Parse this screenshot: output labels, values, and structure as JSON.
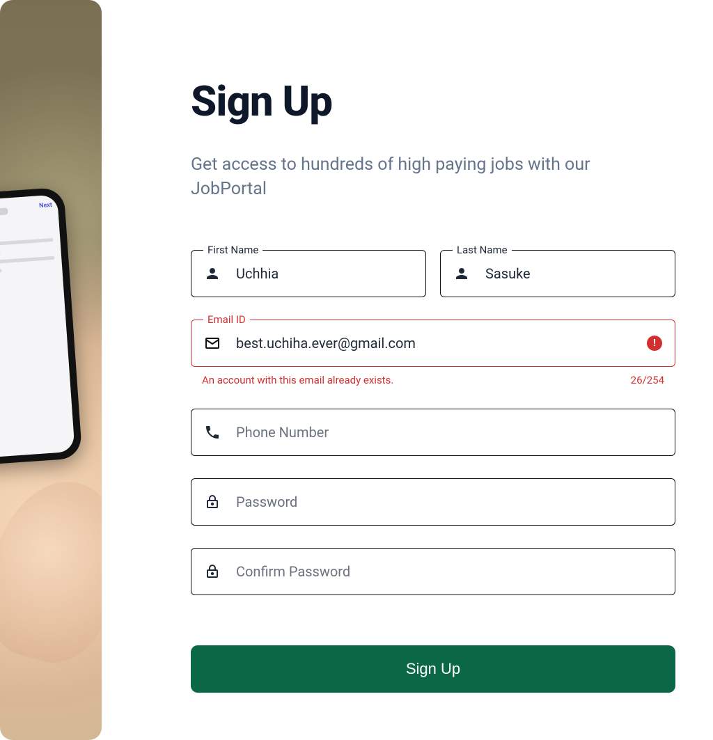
{
  "header": {
    "title": "Sign Up",
    "subtitle": "Get access to hundreds of high paying jobs with our JobPortal"
  },
  "fields": {
    "first_name": {
      "label": "First Name",
      "value": "Uchhia"
    },
    "last_name": {
      "label": "Last Name",
      "value": "Sasuke"
    },
    "email": {
      "label": "Email ID",
      "value": "best.uchiha.ever@gmail.com",
      "error": "An account with this email already exists.",
      "counter": "26/254"
    },
    "phone": {
      "placeholder": "Phone Number"
    },
    "password": {
      "placeholder": "Password"
    },
    "confirm_password": {
      "placeholder": "Confirm Password"
    }
  },
  "button": {
    "submit": "Sign Up"
  },
  "icons": {
    "person": "person-icon",
    "mail": "mail-icon",
    "phone": "phone-icon",
    "lock": "lock-icon",
    "error": "error-icon"
  },
  "colors": {
    "primary": "#0a6847",
    "error": "#d32f2f",
    "text_muted": "#64748b"
  }
}
